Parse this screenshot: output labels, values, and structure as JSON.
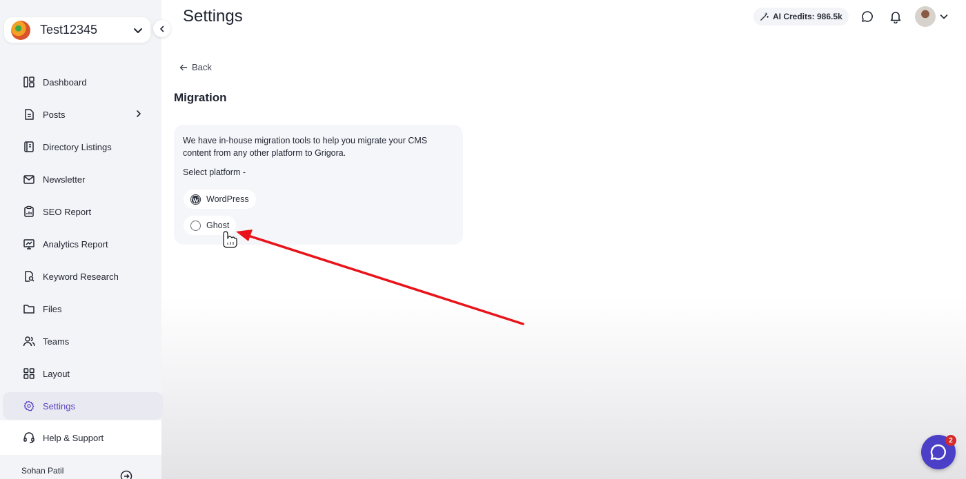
{
  "workspace": {
    "name": "Test12345"
  },
  "sidebar": {
    "items": [
      {
        "label": "Dashboard",
        "icon": "dashboard-icon"
      },
      {
        "label": "Posts",
        "icon": "posts-icon",
        "has_submenu": true
      },
      {
        "label": "Directory Listings",
        "icon": "directory-icon"
      },
      {
        "label": "Newsletter",
        "icon": "mail-icon"
      },
      {
        "label": "SEO Report",
        "icon": "seo-report-icon"
      },
      {
        "label": "Analytics Report",
        "icon": "analytics-icon"
      },
      {
        "label": "Keyword Research",
        "icon": "keyword-search-icon"
      },
      {
        "label": "Files",
        "icon": "folder-icon"
      },
      {
        "label": "Teams",
        "icon": "users-icon"
      },
      {
        "label": "Layout",
        "icon": "layout-grid-icon"
      },
      {
        "label": "Settings",
        "icon": "gear-icon",
        "active": true
      },
      {
        "label": "Help & Support",
        "icon": "headset-icon"
      }
    ],
    "user_name": "Sohan Patil"
  },
  "header": {
    "title": "Settings",
    "credits": "AI Credits: 986.5k"
  },
  "main": {
    "back_label": "Back",
    "section_title": "Migration",
    "description": "We have in-house migration tools to help you migrate your CMS content from any other platform to Grigora.",
    "select_label": "Select platform -",
    "platforms": [
      {
        "label": "WordPress",
        "icon": "wordpress-icon"
      },
      {
        "label": "Ghost",
        "icon": "radio-icon"
      }
    ]
  },
  "chat": {
    "badge": "2"
  },
  "colors": {
    "accent": "#5b3fc4",
    "chat_button": "#4b3fc7",
    "annotation_arrow": "#e8141a",
    "badge": "#d42a2a"
  }
}
